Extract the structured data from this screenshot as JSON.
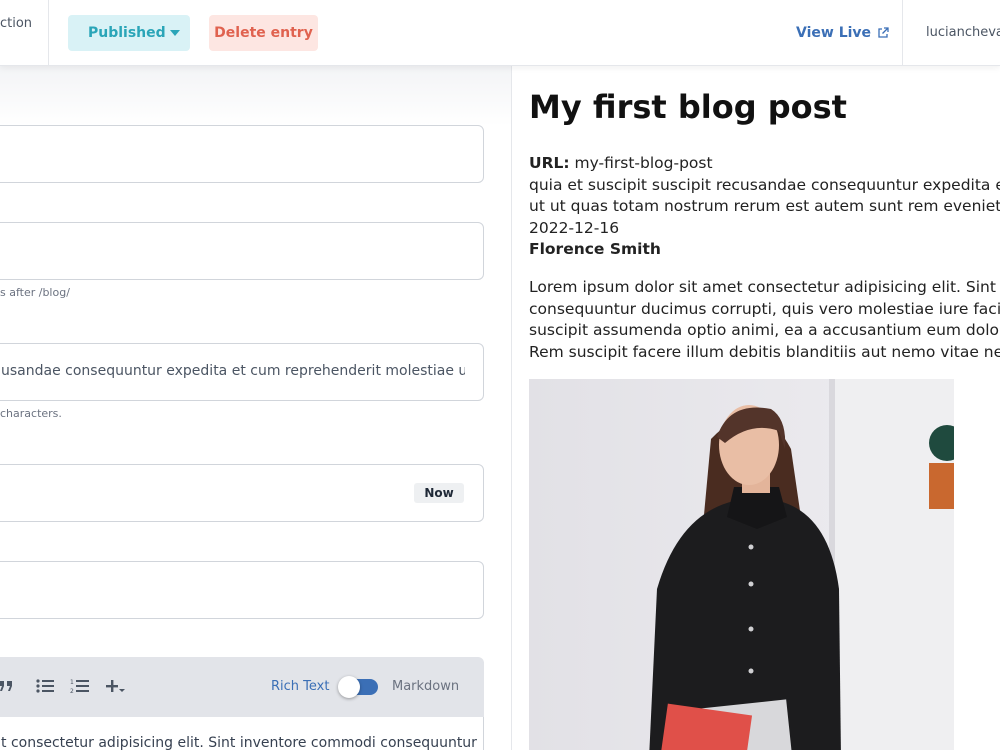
{
  "header": {
    "collection_cut": "ction",
    "status_label": "Published",
    "delete_label": "Delete entry",
    "view_live_label": "View Live",
    "user_name": "luciancheval"
  },
  "editor": {
    "fields": [
      {
        "value": "",
        "hint": ""
      },
      {
        "value": "",
        "hint": "s after /blog/"
      },
      {
        "value": "usandae consequuntur expedita et cum reprehenderit molestiae ut ut c",
        "hint": "characters."
      },
      {
        "value": "",
        "button": "Now"
      },
      {
        "value": ""
      }
    ],
    "toolbar": {
      "icons": [
        "quote-icon",
        "bullet-list-icon",
        "numbered-list-icon",
        "add-block-icon"
      ],
      "rich_text_label": "Rich Text",
      "markdown_label": "Markdown",
      "mode": "Rich Text"
    },
    "body_preview": "t consectetur adipisicing elit. Sint inventore commodi consequuntur"
  },
  "preview": {
    "title": "My first blog post",
    "url_label": "URL:",
    "url_value": "my-first-blog-post",
    "excerpt_line1": "quia et suscipit suscipit recusandae consequuntur expedita et c",
    "excerpt_line2": "ut ut quas totam nostrum rerum est autem sunt rem eveniet arch",
    "date": "2022-12-16",
    "author": "Florence Smith",
    "body_lines": [
      "Lorem ipsum dolor sit amet consectetur adipisicing elit. Sint inve",
      "consequuntur ducimus corrupti, quis vero molestiae iure facilis a",
      "suscipit assumenda optio animi, ea a accusantium eum dolor fac",
      "Rem suscipit facere illum debitis blanditiis aut nemo vitae necess"
    ]
  },
  "colors": {
    "status_bg": "#d9f2f6",
    "status_text": "#2aa5b8",
    "delete_bg": "#fde6e2",
    "delete_text": "#e0624f",
    "link_blue": "#3b6fb6"
  }
}
